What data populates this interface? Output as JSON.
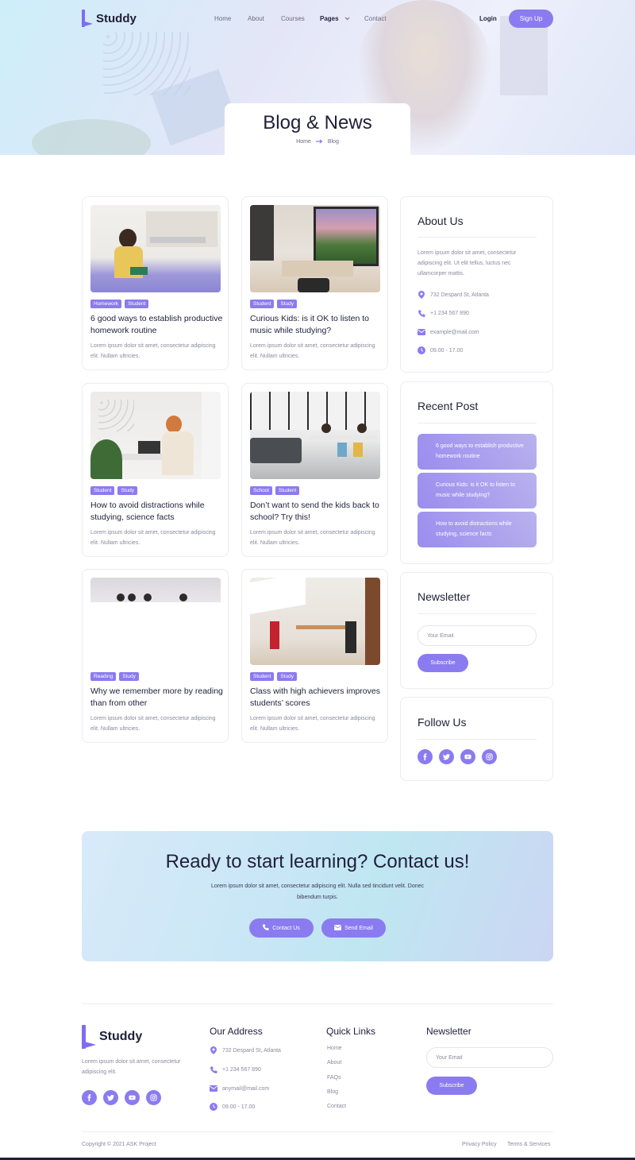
{
  "brand": {
    "name": "Studdy",
    "accent": "#8b7bf0",
    "text": "#1f1f3a"
  },
  "nav": {
    "links": [
      "Home",
      "About",
      "Courses",
      "Pages",
      "Contact"
    ],
    "login": "Login",
    "signup": "Sign Up"
  },
  "hero": {
    "title": "Blog & News",
    "breadcrumb": [
      "Home",
      "Blog"
    ]
  },
  "posts": [
    {
      "tags": [
        "Homework",
        "Student"
      ],
      "title": "6 good ways to establish productive homework routine",
      "excerpt": "Lorem ipsum dolor sit amet, consectetur adipiscing elit. Nullam ultricies."
    },
    {
      "tags": [
        "Student",
        "Study"
      ],
      "title": "Curious Kids: is it OK to listen to music while studying?",
      "excerpt": "Lorem ipsum dolor sit amet, consectetur adipiscing elit. Nullam ultricies."
    },
    {
      "tags": [
        "Student",
        "Study"
      ],
      "title": "How to avoid distractions while studying, science facts",
      "excerpt": "Lorem ipsum dolor sit amet, consectetur adipiscing elit. Nullam ultricies."
    },
    {
      "tags": [
        "School",
        "Student"
      ],
      "title": "Don’t want to send the kids back to school? Try this!",
      "excerpt": "Lorem ipsum dolor sit amet, consectetur adipiscing elit. Nullam ultricies."
    },
    {
      "tags": [
        "Reading",
        "Study"
      ],
      "title": "Why we remember more by reading than from other",
      "excerpt": "Lorem ipsum dolor sit amet, consectetur adipiscing elit. Nullam ultricies."
    },
    {
      "tags": [
        "Student",
        "Study"
      ],
      "title": "Class with high achievers improves students’ scores",
      "excerpt": "Lorem ipsum dolor sit amet, consectetur adipiscing elit. Nullam ultricies."
    }
  ],
  "sidebar": {
    "about": {
      "title": "About Us",
      "text": "Lorem ipsum dolor sit amet, consectetur adipiscing elit. Ut elit tellus, luctus nec ullamcorper mattis.",
      "address": "732 Despard St, Atlanta",
      "phone": "+1 234 567 890",
      "email": "example@mail.com",
      "hours": "09.00 - 17.00"
    },
    "recent": {
      "title": "Recent Post",
      "items": [
        "6 good ways to establish productive homework routine",
        "Curious Kids: is it OK to listen to music while studying?",
        "How to avoid distractions while studying, science facts"
      ]
    },
    "newsletter": {
      "title": "Newsletter",
      "placeholder": "Your Email",
      "button": "Subscribe"
    },
    "follow": {
      "title": "Follow Us",
      "icons": [
        "facebook-icon",
        "twitter-icon",
        "youtube-icon",
        "instagram-icon"
      ]
    }
  },
  "cta": {
    "title": "Ready to start learning? Contact us!",
    "text": "Lorem ipsum dolor sit amet, consectetur adipiscing elit. Nulla sed tincidunt velit. Donec bibendum turpis.",
    "contact_btn": "Contact Us",
    "email_btn": "Send Email"
  },
  "footer": {
    "brand_text": "Lorem ipsum dolor sit amet, consectetur adipiscing elit.",
    "address_title": "Our Address",
    "address": "732 Despard St, Atlanta",
    "phone": "+1 234 567 890",
    "email": "anymail@mail.com",
    "hours": "09.00 - 17.00",
    "links_title": "Quick Links",
    "links": [
      "Home",
      "About",
      "FAQs",
      "Blog",
      "Contact"
    ],
    "newsletter_title": "Newsletter",
    "newsletter_placeholder": "Your Email",
    "newsletter_button": "Subscribe",
    "copyright": "Copyright © 2021 ASK Project",
    "privacy": "Privacy Policy",
    "terms": "Terms & Services"
  }
}
